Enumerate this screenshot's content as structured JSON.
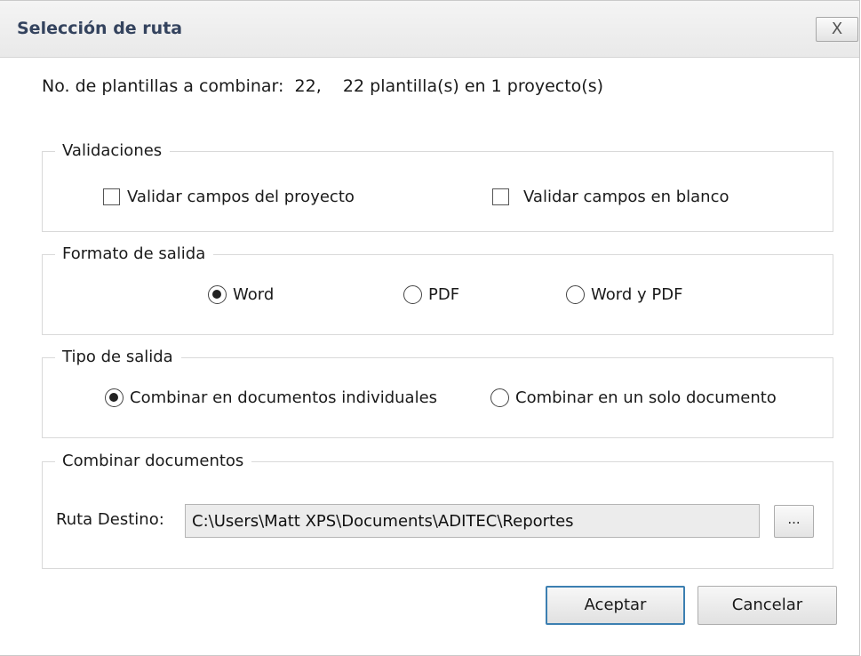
{
  "window": {
    "title": "Selección de ruta",
    "close_label": "X"
  },
  "summary": {
    "label": "No. de plantillas a combinar:",
    "count": "22,",
    "detail": "22 plantilla(s) en 1 proyecto(s)"
  },
  "validaciones": {
    "legend": "Validaciones",
    "options": [
      {
        "label": "Validar campos del proyecto",
        "checked": false
      },
      {
        "label": "Validar campos en blanco",
        "checked": false
      }
    ]
  },
  "formato": {
    "legend": "Formato de salida",
    "options": [
      {
        "label": "Word",
        "selected": true
      },
      {
        "label": "PDF",
        "selected": false
      },
      {
        "label": "Word y PDF",
        "selected": false
      }
    ]
  },
  "tipo": {
    "legend": "Tipo de salida",
    "options": [
      {
        "label": "Combinar en documentos individuales",
        "selected": true
      },
      {
        "label": "Combinar en un solo documento",
        "selected": false
      }
    ]
  },
  "combinar": {
    "legend": "Combinar documentos",
    "path_label": "Ruta Destino:",
    "path_value": "C:\\Users\\Matt XPS\\Documents\\ADITEC\\Reportes",
    "browse_label": "..."
  },
  "buttons": {
    "accept": "Aceptar",
    "cancel": "Cancelar"
  },
  "colors": {
    "title_text": "#34435e",
    "accept_border": "#3c7fb1"
  }
}
